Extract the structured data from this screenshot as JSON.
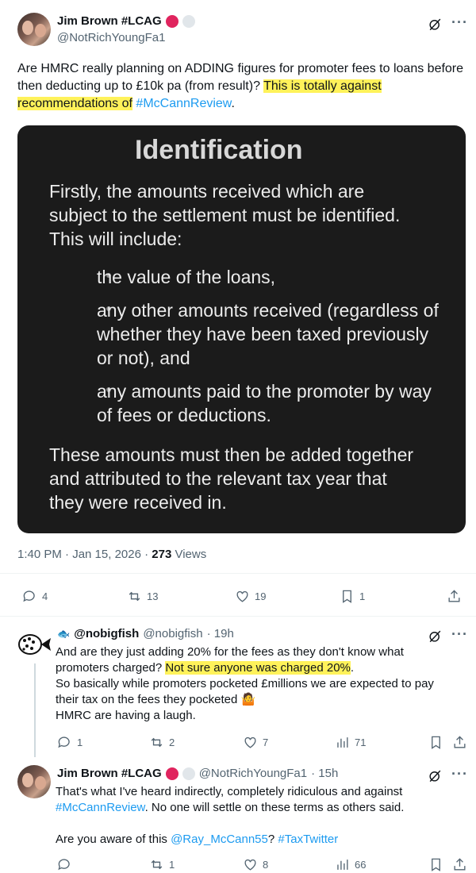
{
  "tweet": {
    "author_name": "Jim Brown #LCAG",
    "author_handle": "@NotRichYoungFa1",
    "text_pre": "Are HMRC really planning on ADDING figures for promoter fees to loans before then deducting up to £10k pa (from result)? ",
    "text_highlight": "This is totally against recommendations of",
    "text_space": " ",
    "text_link": "#McCannReview",
    "text_post": ".",
    "image": {
      "title": "Identification",
      "intro": "Firstly, the amounts received which are subject to the settlement must be identified. This will include:",
      "bullets": [
        "the value of the loans,",
        "any other amounts received (regardless of whether they have been taxed previously or not), and",
        "any amounts paid to the promoter by way of fees or deductions."
      ],
      "outro": "These amounts must then be added together and attributed to the relevant tax year that they were received in."
    },
    "timestamp": "1:40 PM · Jan 15, 2026 · ",
    "views_count": "273",
    "views_label": " Views",
    "replies": "4",
    "reposts": "13",
    "likes": "19",
    "bookmarks": "1"
  },
  "reply1": {
    "emoji": "🐟",
    "author_name": "@nobigfish",
    "author_handle": "@nobigfish",
    "time": "· 19h",
    "line1": "And are they just adding 20% for the fees as they don't know what",
    "line2_pre": "promoters charged? ",
    "line2_highlight": "Not sure anyone was charged 20%",
    "line2_post": ".",
    "line3": "So basically while promoters pocketed £millions we are expected to pay",
    "line4": "their tax on the fees they pocketed 🤷",
    "line5": "HMRC are having a laugh.",
    "replies": "1",
    "reposts": "2",
    "likes": "7",
    "views": "71"
  },
  "reply2": {
    "author_name": "Jim Brown #LCAG",
    "author_handle": "@NotRichYoungFa1",
    "time": "· 15h",
    "line1": "That's what I've heard indirectly, completely ridiculous and against",
    "line2_link": "#McCannReview",
    "line2_post": ". No one will settle on these terms as others said.",
    "line3_pre": "Are you aware of this ",
    "line3_mention": "@Ray_McCann55",
    "line3_mid": "? ",
    "line3_tag": "#TaxTwitter",
    "replies": "",
    "reposts": "1",
    "likes": "8",
    "views": "66"
  },
  "colors": {
    "accent": "#1d9bf0",
    "highlight": "#fff25a",
    "badge_red": "#e0245e"
  }
}
